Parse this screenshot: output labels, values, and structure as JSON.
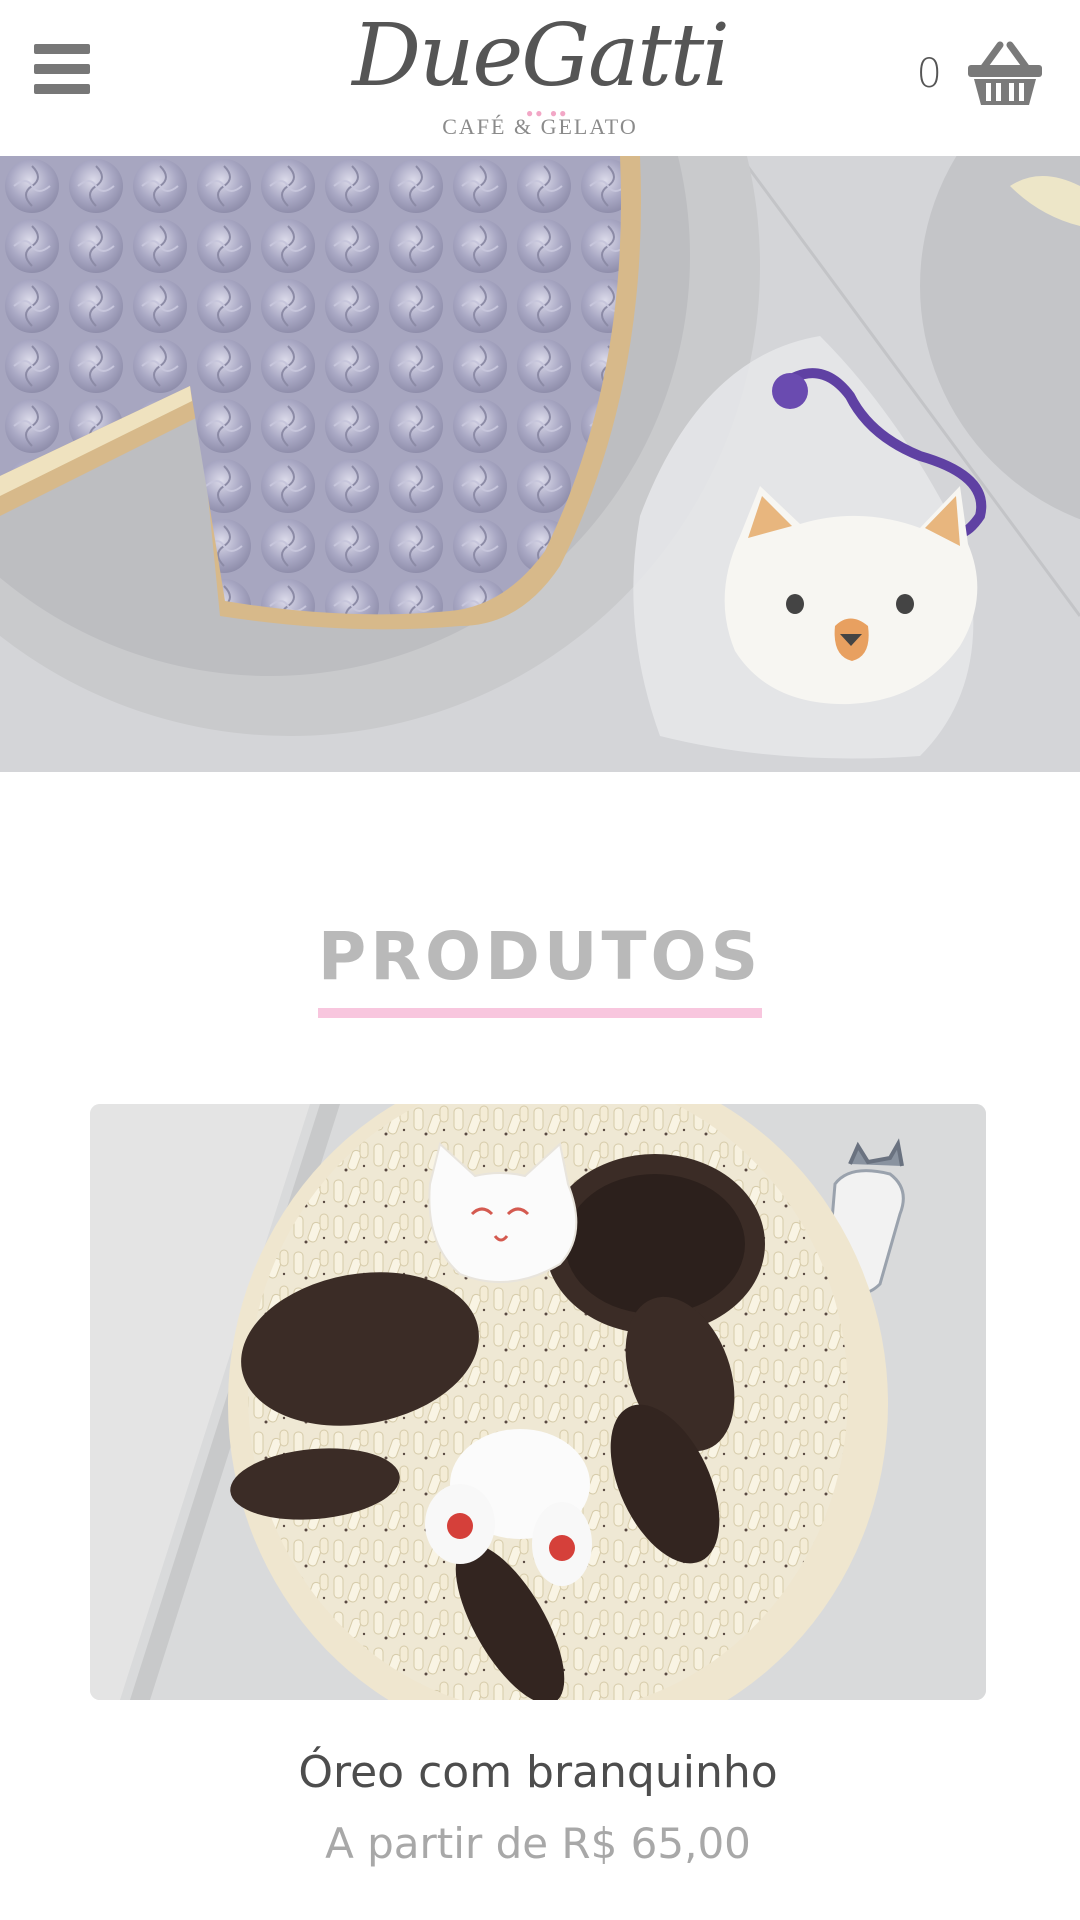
{
  "header": {
    "menu_icon": "hamburger-menu-icon",
    "logo": {
      "script_text": "DueGatti",
      "subtitle": "CAFÉ & GELATO"
    },
    "cart": {
      "count": "0",
      "icon": "shopping-basket-icon"
    }
  },
  "hero": {
    "image_subject": "lavender meringue tart slice and cat cookie in cellophane bag"
  },
  "section": {
    "title": "PRODUTOS",
    "accent_color": "#f8c6de"
  },
  "products": [
    {
      "name": "Óreo com branquinho",
      "price": "A partir de R$ 65,00"
    }
  ],
  "colors": {
    "title_gray": "#b9b9b9",
    "icon_gray": "#777777",
    "pink_accent": "#f8c6de"
  }
}
